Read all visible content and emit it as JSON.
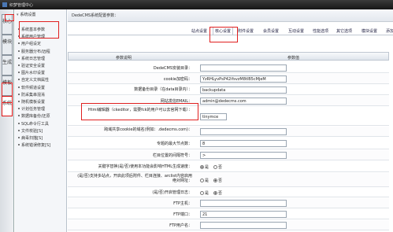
{
  "window": {
    "title": "织梦管理中心"
  },
  "sidenav": {
    "tabs": [
      {
        "label": "核心",
        "active": false
      },
      {
        "label": "模块",
        "active": false
      },
      {
        "label": "生成",
        "active": false
      },
      {
        "label": "模板",
        "active": false
      },
      {
        "label": "系统",
        "active": true
      }
    ]
  },
  "menu": {
    "heading": "系统设置",
    "items": [
      {
        "label": "系统基本参数"
      },
      {
        "label": "系统用户管理"
      },
      {
        "label": "用户组设定"
      },
      {
        "label": "服务器分布/远程"
      },
      {
        "label": "系统日志管理"
      },
      {
        "label": "验证安全设置"
      },
      {
        "label": "图片水印设置"
      },
      {
        "label": "自定义文档属性"
      },
      {
        "label": "软件频道设置"
      },
      {
        "label": "防采集串混淆"
      },
      {
        "label": "随机模板设置"
      },
      {
        "label": "计划任务管理"
      },
      {
        "label": "数据库备份/还原"
      },
      {
        "label": "SQL命令行工具"
      },
      {
        "label": "文件校验[S]"
      },
      {
        "label": "病毒扫描[S]"
      },
      {
        "label": "系统错误修复[S]"
      }
    ]
  },
  "main": {
    "page_title": "DedeCMS系统配置参数：",
    "tabs": [
      {
        "label": "站点设置",
        "active": false
      },
      {
        "label": "核心设置",
        "active": true
      },
      {
        "label": "附件设置",
        "active": false
      },
      {
        "label": "会员设置",
        "active": false
      },
      {
        "label": "互动设置",
        "active": false
      },
      {
        "label": "性能选项",
        "active": false
      },
      {
        "label": "其它选项",
        "active": false
      },
      {
        "label": "模块设置",
        "active": false
      },
      {
        "label": "添加",
        "active": false
      }
    ],
    "columns": {
      "name": "参数说明",
      "value": "参数值"
    },
    "rows": [
      {
        "label": "DedeCMS安装目录：",
        "kind": "input",
        "value": ""
      },
      {
        "label": "cookie加密码：",
        "kind": "input",
        "value": "YzRHLyvPsP42ifsvzM8tlB5cMjeM"
      },
      {
        "label": "数据备份目录（在data目录内）：",
        "kind": "input",
        "value": "backupdata"
      },
      {
        "label": "网站发信EMAIL：",
        "kind": "input",
        "value": "admin@dedecms.com"
      },
      {
        "label": "Html编辑器（ckeditor，需要fck的用户可以去官网下载）：",
        "kind": "input",
        "value": "tinymce"
      },
      {
        "label": "跨域共享cookie的域名(例如：.dedecms.com)：",
        "kind": "input",
        "value": ""
      },
      {
        "label": "专题的最大节点数：",
        "kind": "input",
        "value": "8"
      },
      {
        "label": "栏目位置的间隔符号：",
        "kind": "input",
        "value": ">"
      },
      {
        "label": "关键字替换(是/否)使用本功能会影响HTML生成速度：",
        "kind": "radio",
        "yes": "是",
        "no": "否",
        "selected": "yes"
      },
      {
        "label": "(是/否)支持多站点，开启此项后附件、栏目连接、arclist内容启用绝对网址：",
        "kind": "radio",
        "yes": "是",
        "no": "否",
        "selected": "no"
      },
      {
        "label": "(是/否)开启管理日志：",
        "kind": "radio",
        "yes": "是",
        "no": "否",
        "selected": "no"
      },
      {
        "label": "FTP主机：",
        "kind": "input",
        "value": ""
      },
      {
        "label": "FTP端口：",
        "kind": "input",
        "value": "21"
      },
      {
        "label": "FTP用户名：",
        "kind": "input",
        "value": ""
      },
      {
        "label": "FTP密码：",
        "kind": "input",
        "value": ""
      }
    ]
  },
  "colors": {
    "highlight": "#e02020",
    "topbar": "#222222"
  }
}
